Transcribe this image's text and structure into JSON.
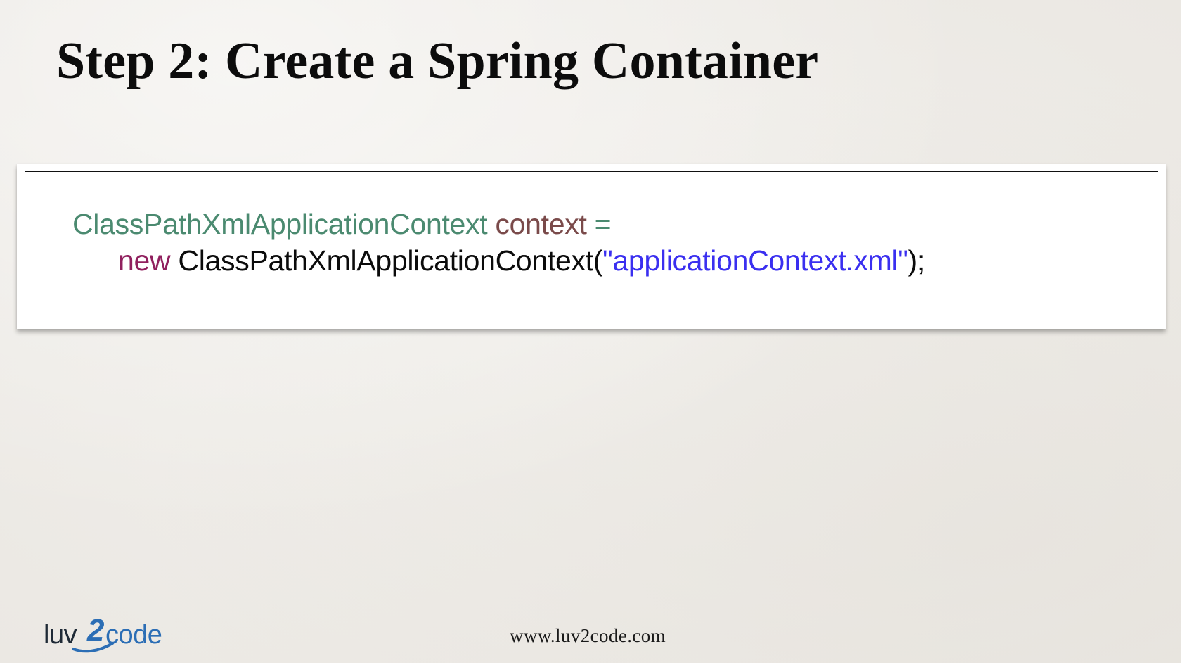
{
  "slide": {
    "title": "Step 2: Create a Spring Container"
  },
  "code": {
    "line1": {
      "type": "ClassPathXmlApplicationContext",
      "variable": "context",
      "equals": "="
    },
    "line2": {
      "keyword": "new",
      "constructor": "ClassPathXmlApplicationContext(",
      "string": "\"applicationContext.xml\"",
      "close": ");"
    }
  },
  "footer": {
    "url": "www.luv2code.com",
    "logo": {
      "part1": "luv",
      "part2": "2",
      "part3": "code"
    }
  },
  "colors": {
    "background": "#f1efeb",
    "type": "#4b8a70",
    "variable": "#7a4a4a",
    "keyword": "#90205e",
    "string": "#3a2ff0",
    "logo_blue": "#2c6eb5"
  }
}
